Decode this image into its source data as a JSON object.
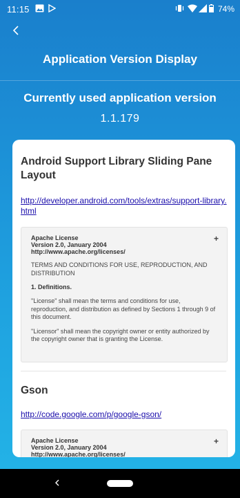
{
  "status_bar": {
    "time": "11:15",
    "battery_pct": "74%"
  },
  "header": {
    "title": "Application Version Display"
  },
  "version_section": {
    "label": "Currently used application version",
    "version": "1.1.179"
  },
  "libraries": [
    {
      "name": "Android Support Library Sliding Pane Layout",
      "url": "http://developer.android.com/tools/extras/support-library.html",
      "license": {
        "head_line1": "Apache License",
        "head_line2": "Version 2.0, January 2004",
        "head_line3": "http://www.apache.org/licenses/",
        "terms": "TERMS AND CONDITIONS FOR USE, REPRODUCTION, AND DISTRIBUTION",
        "definitions": "1. Definitions.",
        "def_license": "\"License\" shall mean the terms and conditions for use, reproduction, and distribution as defined by Sections 1 through 9 of this document.",
        "def_licensor": "\"Licensor\" shall mean the copyright owner or entity authorized by the copyright owner that is granting the License.",
        "expand_symbol": "+"
      }
    },
    {
      "name": "Gson",
      "url": "http://code.google.com/p/google-gson/",
      "license": {
        "head_line1": "Apache License",
        "head_line2": "Version 2.0, January 2004",
        "head_line3": "http://www.apache.org/licenses/",
        "expand_symbol": "+"
      }
    }
  ],
  "colors": {
    "header_gradient_top": "#1a7fcc",
    "header_gradient_bottom": "#23b2e6",
    "link": "#1a0dab",
    "card": "#ffffff"
  },
  "icons": {
    "back": "chevron-left-icon",
    "gallery": "image-icon",
    "play_store": "play-icon",
    "vibrate": "vibrate-icon",
    "wifi": "wifi-icon",
    "signal": "signal-icon",
    "battery": "battery-icon"
  }
}
